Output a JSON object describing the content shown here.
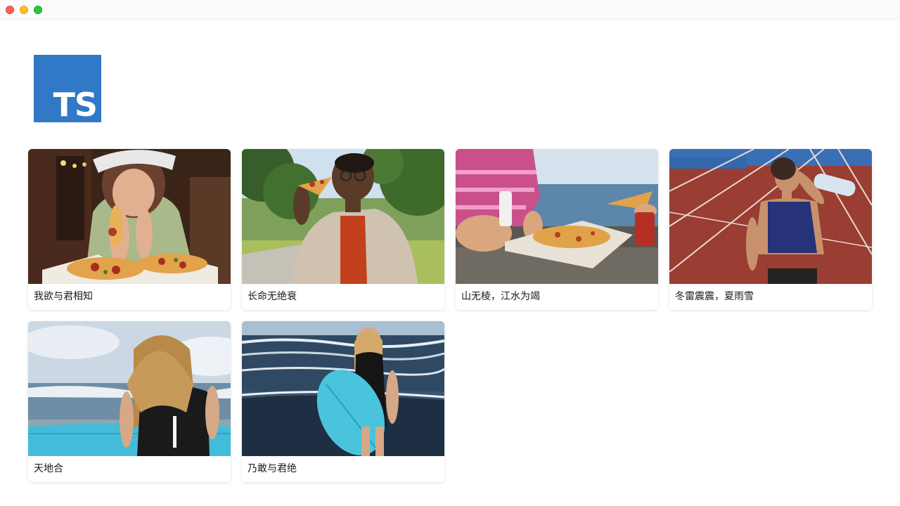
{
  "window": {
    "controls": {
      "close_icon": "close-icon",
      "minimize_icon": "minimize-icon",
      "maximize_icon": "maximize-icon"
    }
  },
  "logo": {
    "text": "TS",
    "background": "#3178c6"
  },
  "cards": [
    {
      "caption": "我欲与君相知",
      "image": "woman eating pizza in a restaurant"
    },
    {
      "caption": "长命无绝衰",
      "image": "man in glasses eating pizza in a park"
    },
    {
      "caption": "山无棱，江水为竭",
      "image": "pizza box on a seaside wall"
    },
    {
      "caption": "冬雷震震，夏雨雪",
      "image": "athlete drinking water on a running track"
    },
    {
      "caption": "天地合",
      "image": "woman with surfboard facing the sea"
    },
    {
      "caption": "乃敢与君绝",
      "image": "smiling surfer holding a surfboard on the beach"
    }
  ]
}
